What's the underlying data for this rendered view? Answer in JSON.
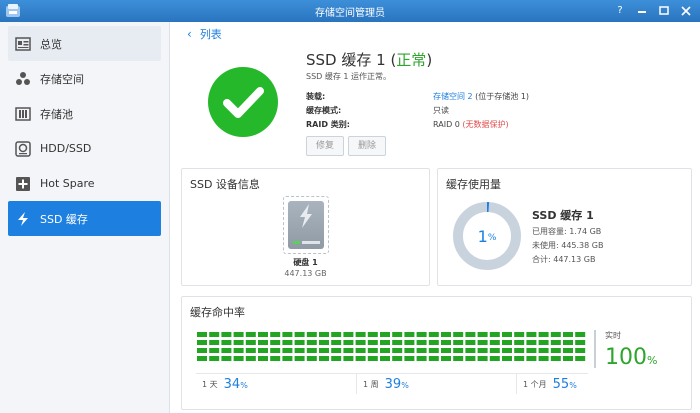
{
  "window": {
    "title": "存储空间管理员",
    "help_icon": "?"
  },
  "sidebar": {
    "items": [
      {
        "label": "总览",
        "icon": "overview-icon"
      },
      {
        "label": "存储空间",
        "icon": "volume-icon"
      },
      {
        "label": "存储池",
        "icon": "storage-pool-icon"
      },
      {
        "label": "HDD/SSD",
        "icon": "hdd-icon"
      },
      {
        "label": "Hot Spare",
        "icon": "hot-spare-icon"
      },
      {
        "label": "SSD 缓存",
        "icon": "ssd-cache-icon"
      }
    ]
  },
  "header": {
    "back_label": "列表"
  },
  "summary": {
    "title_prefix": "SSD 缓存 1 (",
    "status": "正常",
    "title_suffix": ")",
    "subtitle": "SSD 缓存 1 运作正常。",
    "fields": [
      {
        "key": "装载:",
        "value_link": "存储空间 2",
        "value_rest": " (位于存储池 1)"
      },
      {
        "key": "缓存模式:",
        "value": "只读"
      },
      {
        "key": "RAID 类别:",
        "value": "RAID 0",
        "warning": " (无数据保护)"
      }
    ],
    "repair_label": "修复",
    "delete_label": "删除"
  },
  "device_card": {
    "title": "SSD 设备信息",
    "disk_name": "硬盘 1",
    "disk_size": "447.13 GB"
  },
  "usage_card": {
    "title": "缓存使用量",
    "percent": "1",
    "percent_unit": "%",
    "percent_value": 1,
    "name": "SSD 缓存 1",
    "used": "已用容量: 1.74 GB",
    "unused": "未使用: 445.38 GB",
    "total": "合计: 447.13 GB"
  },
  "hit_card": {
    "title": "缓存命中率",
    "realtime_label": "实时",
    "realtime_value": "100",
    "realtime_unit": "%",
    "periods": [
      {
        "label": "1 天",
        "value": "34",
        "unit": "%"
      },
      {
        "label": "1 周",
        "value": "39",
        "unit": "%"
      },
      {
        "label": "1 个月",
        "value": "55",
        "unit": "%"
      }
    ]
  },
  "colors": {
    "accent": "#1d7fe0",
    "ok": "#25b82a",
    "warning": "#e24a4a"
  }
}
